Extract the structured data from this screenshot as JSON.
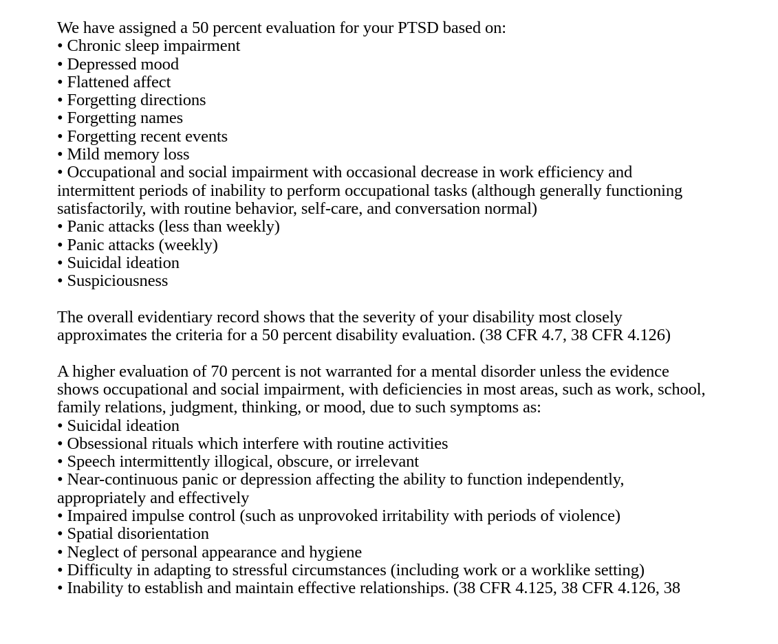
{
  "document": {
    "section1": {
      "intro": "We have assigned a 50 percent evaluation for your PTSD based on:",
      "bullets": [
        [
          "Chronic sleep impairment"
        ],
        [
          "Depressed mood"
        ],
        [
          "Flattened affect"
        ],
        [
          "Forgetting directions"
        ],
        [
          "Forgetting names"
        ],
        [
          "Forgetting recent events"
        ],
        [
          "Mild memory loss"
        ],
        [
          "Occupational and social impairment with occasional decrease in work efficiency and",
          "intermittent periods of inability to perform occupational tasks (although generally functioning",
          "satisfactorily, with routine behavior, self-care, and conversation normal)"
        ],
        [
          "Panic attacks (less than weekly)"
        ],
        [
          "Panic attacks (weekly)"
        ],
        [
          "Suicidal ideation"
        ],
        [
          "Suspiciousness"
        ]
      ]
    },
    "section2": {
      "lines": [
        "The overall evidentiary record shows that the severity of your disability most closely",
        "approximates the criteria for a 50 percent disability evaluation. (38 CFR 4.7, 38 CFR 4.126)"
      ]
    },
    "section3": {
      "intro_lines": [
        "A higher evaluation of 70 percent is not warranted for a mental disorder unless the evidence",
        "shows occupational and social impairment, with deficiencies in most areas, such as work, school,",
        "family relations, judgment, thinking, or mood, due to such symptoms as:"
      ],
      "bullets": [
        [
          "Suicidal ideation"
        ],
        [
          "Obsessional rituals which interfere with routine activities"
        ],
        [
          "Speech intermittently illogical, obscure, or irrelevant"
        ],
        [
          "Near-continuous panic or depression affecting the ability to function independently,",
          "appropriately and effectively"
        ],
        [
          "Impaired impulse control (such as unprovoked irritability with periods of violence)"
        ],
        [
          "Spatial disorientation"
        ],
        [
          "Neglect of personal appearance and hygiene"
        ],
        [
          "Difficulty in adapting to stressful circumstances (including work or a worklike setting)"
        ],
        [
          "Inability to establish and maintain effective relationships. (38 CFR 4.125, 38 CFR 4.126, 38"
        ]
      ]
    }
  }
}
